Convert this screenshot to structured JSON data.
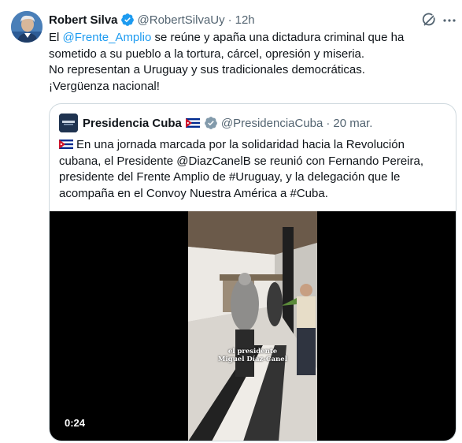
{
  "tweet": {
    "author_name": "Robert Silva",
    "handle": "@RobertSilvaUy",
    "separator": "·",
    "time": "12h",
    "lines": [
      {
        "pre": "El ",
        "mention": "@Frente_Amplio",
        "post": " se reúne y apaña una dictadura criminal que ha"
      },
      {
        "text": "sometido a su pueblo a la tortura, cárcel, opresión y miseria."
      },
      {
        "text": "No representan a Uruguay y sus tradicionales democráticas."
      },
      {
        "text": "¡Vergüenza nacional!"
      }
    ],
    "icons": {
      "verified": "verified-badge-icon",
      "grok": "grok-icon",
      "more": "more-options-icon"
    },
    "colors": {
      "accent": "#1d9bf0",
      "secondary_text": "#536471",
      "border": "#cfd9de"
    }
  },
  "quote": {
    "author_name": "Presidencia Cuba",
    "handle": "@PresidenciaCuba",
    "separator": "·",
    "time": "20 mar.",
    "lines": [
      "En una jornada marcada por la solidaridad hacia la Revolución",
      "cubana, el Presidente @DiazCanelB se reunió con Fernando Pereira,",
      "presidente del Frente Amplio de #Uruguay, y la delegación que le",
      "acompaña en el Convoy Nuestra América a #Cuba."
    ],
    "video": {
      "caption_line1": "el presidente",
      "caption_line2": "Miguel Díaz-Canel",
      "duration": "0:24"
    }
  }
}
